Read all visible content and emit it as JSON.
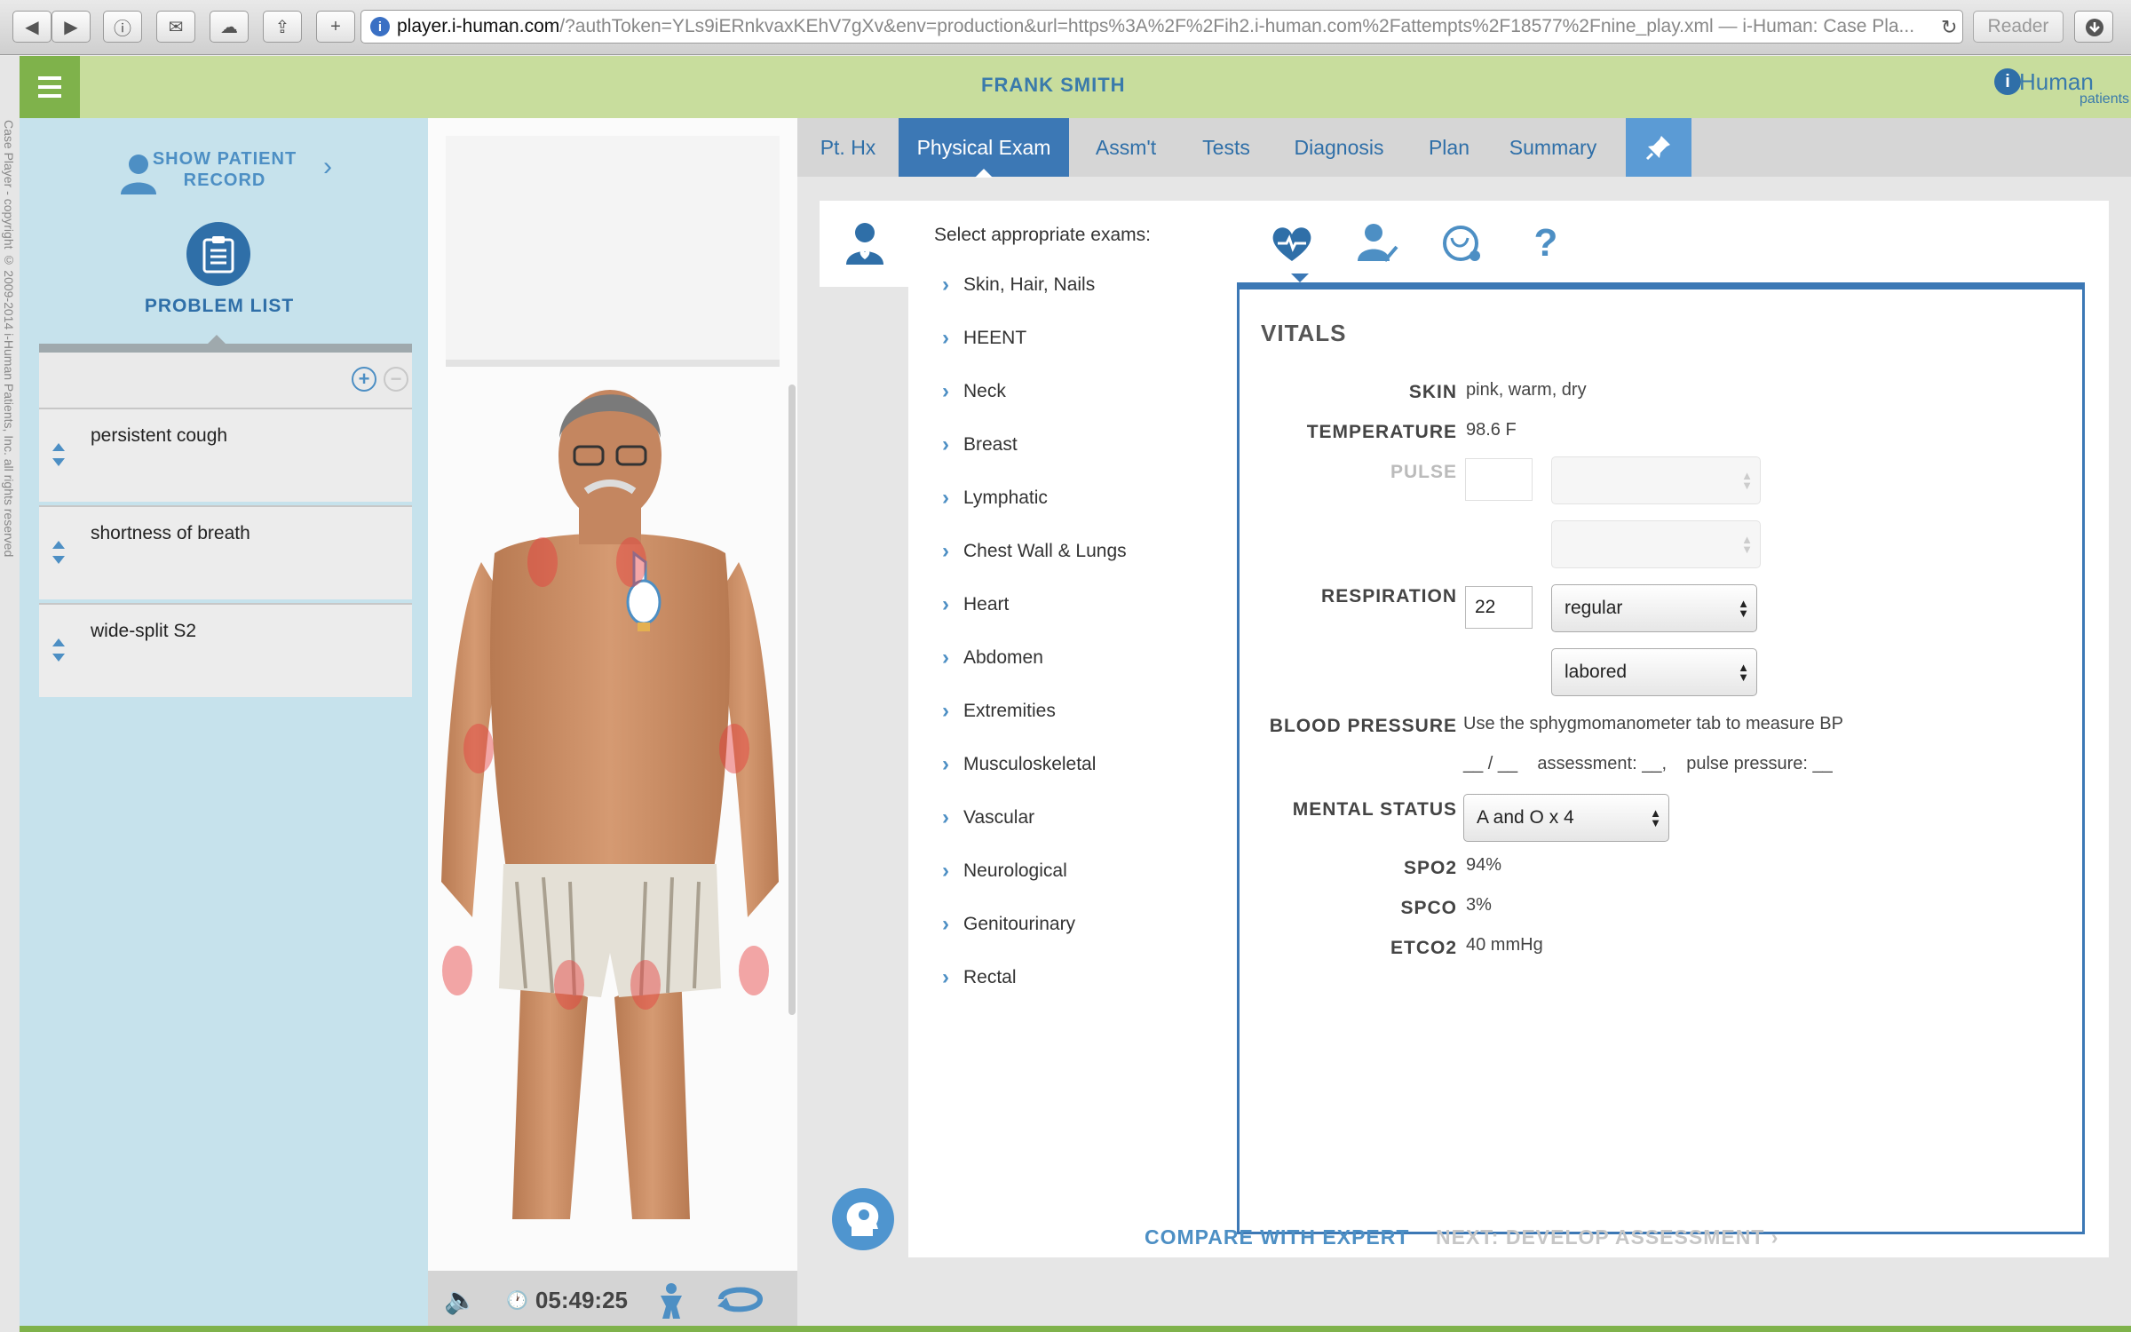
{
  "browser": {
    "url_host": "player.i-human.com",
    "url_rest": "/?authToken=YLs9iERnkvaxKEhV7gXv&env=production&url=https%3A%2F%2Fih2.i-human.com%2Fattempts%2F18577%2Fnine_play.xml — i-Human: Case Pla...",
    "reader_label": "Reader"
  },
  "app": {
    "copyright": "Case Player - copyright © 2009-2014 i-Human Patients, Inc. all rights reserved",
    "patient_name": "FRANK SMITH",
    "logo_text": "Human",
    "logo_sub": "patients"
  },
  "sidebar": {
    "show_record_label": "SHOW PATIENT RECORD",
    "problem_list_title": "PROBLEM LIST",
    "problems": [
      {
        "label": "persistent cough"
      },
      {
        "label": "shortness of breath"
      },
      {
        "label": "wide-split S2"
      }
    ]
  },
  "avatar": {
    "timer": "05:49:25"
  },
  "tabs": [
    {
      "label": "Pt. Hx",
      "active": false
    },
    {
      "label": "Physical Exam",
      "active": true
    },
    {
      "label": "Assm't",
      "active": false
    },
    {
      "label": "Tests",
      "active": false
    },
    {
      "label": "Diagnosis",
      "active": false
    },
    {
      "label": "Plan",
      "active": false
    },
    {
      "label": "Summary",
      "active": false
    }
  ],
  "exam": {
    "prompt": "Select appropriate exams:",
    "items": [
      "Skin, Hair, Nails",
      "HEENT",
      "Neck",
      "Breast",
      "Lymphatic",
      "Chest Wall & Lungs",
      "Heart",
      "Abdomen",
      "Extremities",
      "Musculoskeletal",
      "Vascular",
      "Neurological",
      "Genitourinary",
      "Rectal"
    ],
    "subtab_help": "?"
  },
  "vitals": {
    "title": "VITALS",
    "skin_label": "SKIN",
    "skin_value": "pink, warm, dry",
    "temperature_label": "TEMPERATURE",
    "temperature_value": "98.6 F",
    "pulse_label": "PULSE",
    "respiration_label": "RESPIRATION",
    "respiration_rate": "22",
    "respiration_rhythm": "regular",
    "respiration_effort": "labored",
    "bp_label": "BLOOD PRESSURE",
    "bp_note": "Use the sphygmomanometer tab to measure BP",
    "bp_line": "__ / __    assessment: __,    pulse pressure: __",
    "mental_label": "MENTAL STATUS",
    "mental_value": "A and O x 4",
    "spo2_label": "SPO2",
    "spo2_value": "94%",
    "spco_label": "SPCO",
    "spco_value": "3%",
    "etco2_label": "ETCO2",
    "etco2_value": "40 mmHg"
  },
  "footer": {
    "compare_label": "COMPARE WITH EXPERT",
    "next_label": "NEXT: DEVELOP ASSESSMENT"
  },
  "colors": {
    "accent": "#3c78b5",
    "header_green": "#c8dd9d",
    "menu_green": "#7fb24b",
    "sidebar_blue": "#c6e2ec"
  }
}
